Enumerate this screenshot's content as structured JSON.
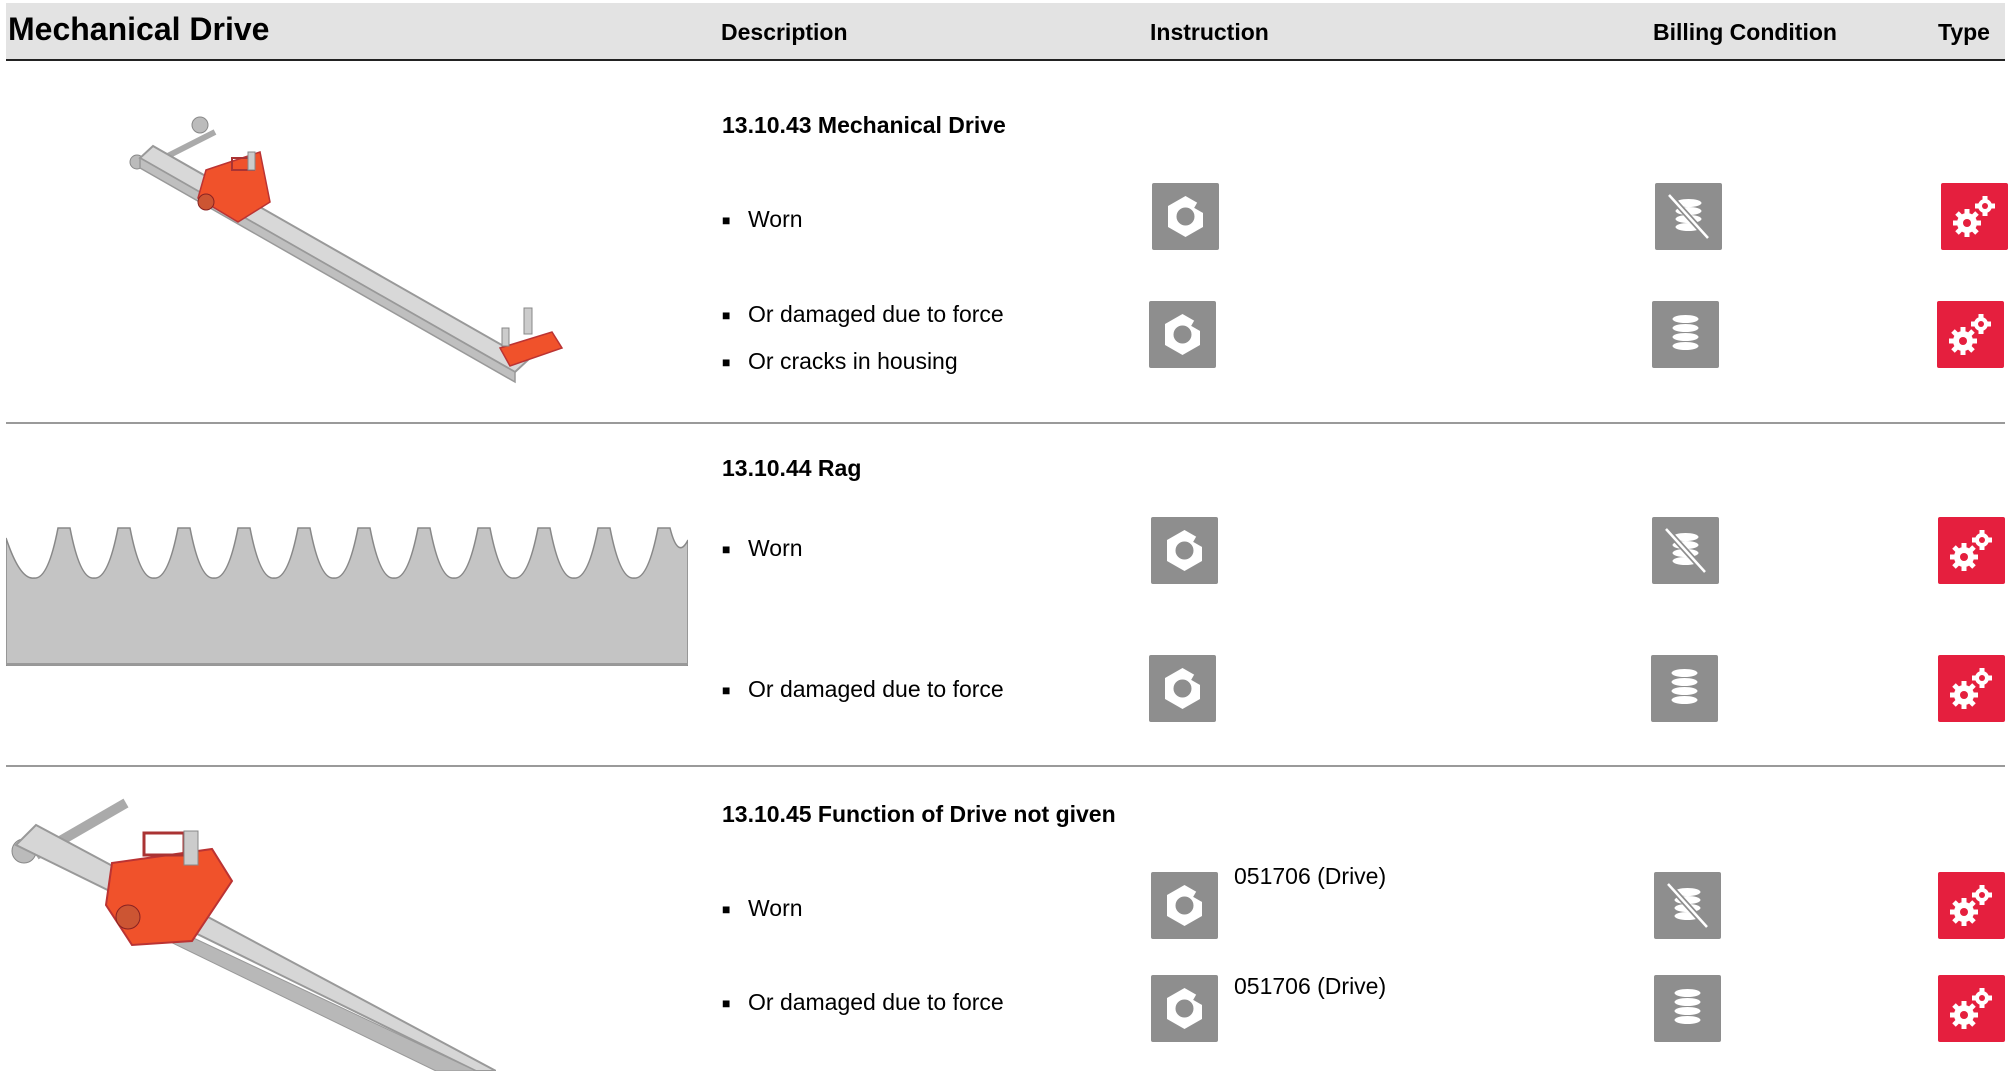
{
  "header": {
    "title": "Mechanical Drive",
    "columns": [
      "Description",
      "Instruction",
      "Billing Condition",
      "Type"
    ]
  },
  "sections": [
    {
      "title": "13.10.43 Mechanical Drive",
      "rows": [
        {
          "lines": [
            "Worn"
          ],
          "instruction_icon": "nut-icon",
          "billing_icon": "no-billing-icon",
          "type_icon": "gears-icon"
        },
        {
          "lines": [
            "Or damaged due to force",
            "Or cracks in housing"
          ],
          "instruction_icon": "nut-icon",
          "billing_icon": "billing-icon",
          "type_icon": "gears-icon"
        }
      ]
    },
    {
      "title": "13.10.44 Rag",
      "rows": [
        {
          "lines": [
            "Worn"
          ],
          "instruction_icon": "nut-icon",
          "billing_icon": "no-billing-icon",
          "type_icon": "gears-icon"
        },
        {
          "lines": [
            "Or damaged due to force"
          ],
          "instruction_icon": "nut-icon",
          "billing_icon": "billing-icon",
          "type_icon": "gears-icon"
        }
      ]
    },
    {
      "title": "13.10.45 Function of Drive not given",
      "rows": [
        {
          "lines": [
            "Worn"
          ],
          "instruction_text": "051706 (Drive)",
          "instruction_icon": "nut-icon",
          "billing_icon": "no-billing-icon",
          "type_icon": "gears-icon"
        },
        {
          "lines": [
            "Or damaged due to force"
          ],
          "instruction_text": "051706 (Drive)",
          "instruction_icon": "nut-icon",
          "billing_icon": "billing-icon",
          "type_icon": "gears-icon"
        }
      ]
    }
  ],
  "colors": {
    "header_bg": "#e3e3e3",
    "icon_gray": "#8e8e8e",
    "type_red": "#e51f3e",
    "part_orange": "#f0522b"
  }
}
